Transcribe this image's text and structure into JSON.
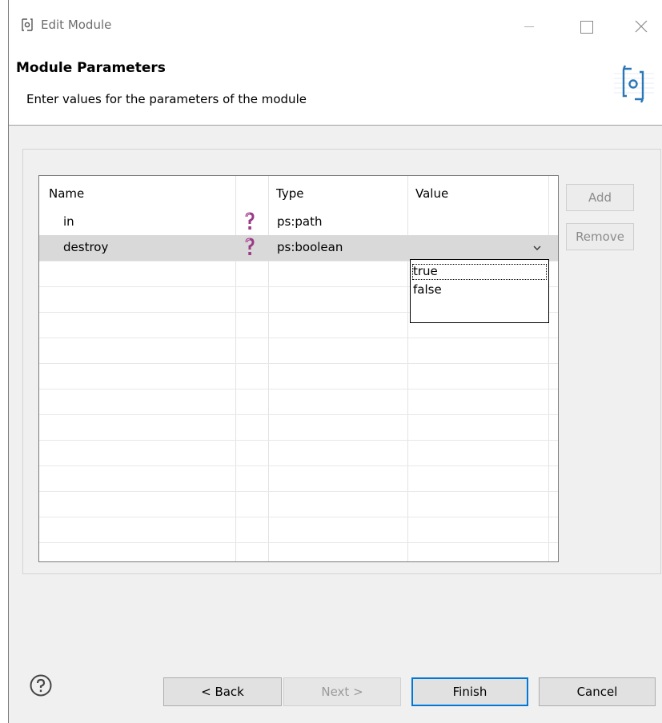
{
  "window": {
    "title": "Edit Module",
    "icon": "module-icon"
  },
  "header": {
    "title": "Module Parameters",
    "subtitle": "Enter values for the parameters of the module",
    "icon": "module-banner-icon"
  },
  "table": {
    "columns": [
      "Name",
      "",
      "Type",
      "Value"
    ],
    "rows": [
      {
        "name": "in",
        "icon": "question-mark-icon",
        "type": "ps:path",
        "value": ""
      },
      {
        "name": "destroy",
        "icon": "question-mark-icon",
        "type": "ps:boolean",
        "value": ""
      }
    ],
    "selected_row": 1
  },
  "value_dropdown": {
    "options": [
      "true",
      "false"
    ],
    "focused": "true"
  },
  "side_buttons": {
    "add": "Add",
    "remove": "Remove"
  },
  "footer": {
    "back": "< Back",
    "next": "Next >",
    "finish": "Finish",
    "cancel": "Cancel"
  },
  "colors": {
    "selection": "#d9d9d9",
    "default_button_border": "#0078d7",
    "question_icon": "#9b3a86"
  }
}
